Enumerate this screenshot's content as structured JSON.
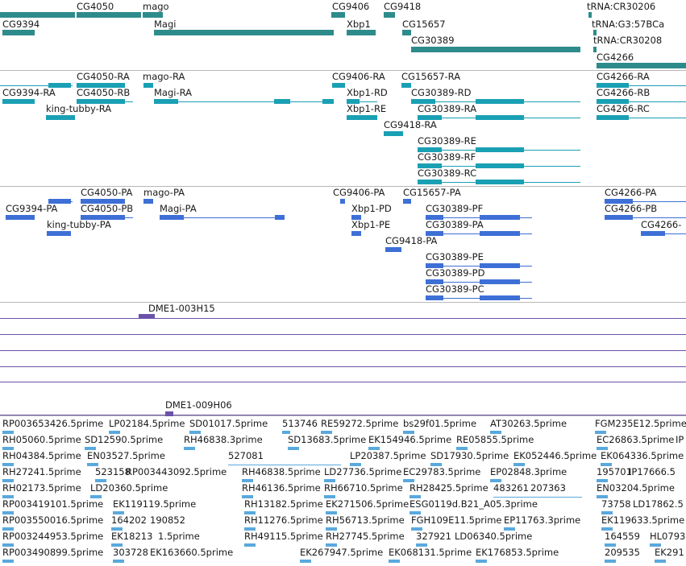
{
  "colors": {
    "gene": "#2e8b8b",
    "transcript": "#1aa0b4",
    "protein": "#3d6fd6",
    "clone": "#6a53a8",
    "est": "#5aa9dd",
    "separator": "#b8b8b8"
  },
  "genes": {
    "labels": [
      "CG4050",
      "mago",
      "CG9406",
      "CG9418",
      "tRNA:CR30206",
      "CG9394",
      "Magi",
      "Xbp1",
      "CG15657",
      "tRNA:G3:57BCa",
      "CG30389",
      "tRNA:CR30208",
      "CG4266"
    ]
  },
  "transcripts": {
    "labels": [
      "CG4050-RA",
      "mago-RA",
      "CG9406-RA",
      "CG15657-RA",
      "CG4266-RA",
      "CG9394-RA",
      "CG4050-RB",
      "Magi-RA",
      "Xbp1-RD",
      "CG30389-RD",
      "CG4266-RB",
      "king-tubby-RA",
      "Xbp1-RE",
      "CG30389-RA",
      "CG4266-RC",
      "CG9418-RA",
      "CG30389-RE",
      "CG30389-RF",
      "CG30389-RC"
    ]
  },
  "proteins": {
    "labels": [
      "CG4050-PA",
      "mago-PA",
      "CG9406-PA",
      "CG15657-PA",
      "CG4266-PA",
      "CG9394-PA",
      "CG4050-PB",
      "Magi-PA",
      "Xbp1-PD",
      "CG30389-PF",
      "CG4266-PB",
      "king-tubby-PA",
      "Xbp1-PE",
      "CG30389-PA",
      "CG4266-",
      "CG9418-PA",
      "CG30389-PE",
      "CG30389-PD",
      "CG30389-PC"
    ]
  },
  "clones": {
    "labels": [
      "DME1-003H15",
      "DME1-009H06"
    ]
  },
  "ests": {
    "labels": [
      "RP003653426.5prime",
      "LP02184.5prime",
      "SD01017.5prime",
      "513746",
      "RE59272.5prime",
      "bs29f01.5prime",
      "AT30263.5prime",
      "FGM235E12.5prime",
      "RH05060.5prime",
      "SD12590.5prime",
      "RH46838.3prime",
      "SD13683.5prime",
      "EK154946.5prime",
      "RE05855.5prime",
      "EC26863.5prime",
      "IP",
      "RH04384.5prime",
      "EN03527.5prime",
      "527081",
      "LP20387.5prime",
      "SD17930.5prime",
      "EK052446.5prime",
      "EK064336.5prime",
      "RH27241.5prime",
      "523158",
      "RP003443092.5prime",
      "RH46838.5prime",
      "LD27736.5prime",
      "EC29783.5prime",
      "EP02848.3prime",
      "195701",
      "IP17666.5",
      "RH02173.5prime",
      "LD20360.5prime",
      "RH46136.5prime",
      "RH66710.5prime",
      "RH28425.5prime",
      "483261",
      "207363",
      "EN03204.5prime",
      "RP003419101.5prime",
      "EK119119.5prime",
      "RH13182.5prime",
      "EK271506.5prime",
      "ESG0119d.B21_A05.3prime",
      "73758",
      "LD17862.5",
      "RP003550016.5prime",
      "164202",
      "190852",
      "RH11276.5prime",
      "RH56713.5prime",
      "FGH109E11.5prime",
      "EP11763.3prime",
      "EK119633.5prime",
      "RP003244953.5prime",
      "EK18213",
      "1.5prime",
      "RH49115.5prime",
      "RH27745.5prime",
      "327921",
      "LD06340.5prime",
      "164559",
      "HL0793",
      "RP003490899.5prime",
      "303728",
      "EK163660.5prime",
      "EK267947.5prime",
      "EK068131.5prime",
      "EK176853.5prime",
      "209535",
      "EK291"
    ]
  }
}
